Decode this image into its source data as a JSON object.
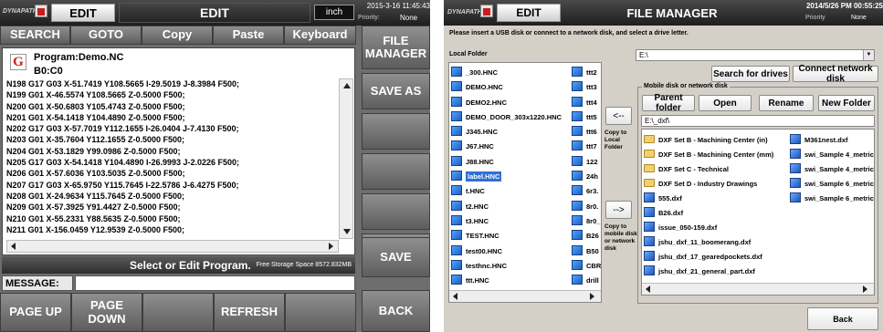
{
  "left": {
    "logo": "DYNAPATH",
    "tab_label": "EDIT",
    "title": "EDIT",
    "unit": "inch",
    "datetime": "2015-3-16 11:45:43",
    "priority_label": "Priority:",
    "priority_value": "None",
    "top_buttons": [
      "SEARCH",
      "GOTO",
      "Copy",
      "Paste",
      "Keyboard"
    ],
    "program_label": "Program:Demo.NC",
    "block": "B0:C0",
    "code_lines": [
      "N198 G17 G03 X-51.7419 Y108.5665 I-29.5019 J-8.3984 F500;",
      "N199 G01 X-46.5574 Y108.5665 Z-0.5000 F500;",
      "N200 G01 X-50.6803 Y105.4743 Z-0.5000 F500;",
      "N201 G01 X-54.1418 Y104.4890 Z-0.5000 F500;",
      "N202 G17 G03 X-57.7019 Y112.1655 I-26.0404 J-7.4130 F500;",
      "N203 G01 X-35.7604 Y112.1655 Z-0.5000 F500;",
      "N204 G01 X-53.1829 Y99.0986 Z-0.5000 F500;",
      "N205 G17 G03 X-54.1418 Y104.4890 I-26.9993 J-2.0226 F500;",
      "N206 G01 X-57.6036 Y103.5035 Z-0.5000 F500;",
      "N207 G17 G03 X-65.9750 Y115.7645 I-22.5786 J-6.4275 F500;",
      "N208 G01 X-24.9634 Y115.7645 Z-0.5000 F500;",
      "N209 G01 X-57.3925 Y91.4427 Z-0.5000 F500;",
      "N210 G01 X-55.2331 Y88.5635 Z-0.5000 F500;",
      "N211 G01 X-156.0459 Y12.9539 Z-0.5000 F500;"
    ],
    "status": "Select or Edit Program.",
    "storage": "Free Storage Space 8572.832MB",
    "message_label": "MESSAGE:",
    "side_buttons": [
      "FILE MANAGER",
      "SAVE AS",
      "",
      "",
      "",
      "",
      "SAVE",
      "BACK"
    ],
    "bottom_buttons": [
      "PAGE UP",
      "PAGE DOWN",
      "",
      "REFRESH",
      ""
    ]
  },
  "right": {
    "logo": "DYNAPATH",
    "tab_label": "EDIT",
    "title": "FILE MANAGER",
    "datetime": "2014/5/26 PM 00:55:25",
    "priority_label": "Priority",
    "priority_value": "None",
    "instruction": "Please insert a USB disk or connect to a network disk, and select a drive letter.",
    "local_folder_label": "Local Folder",
    "drive_value": "E:\\",
    "search_drives": "Search for drives",
    "connect_network": "Connect network disk",
    "mobile_group_label": "Mobile disk or network disk",
    "parent_folder": "Parent folder",
    "open": "Open",
    "rename": "Rename",
    "new_folder": "New Folder",
    "path_value": "E:\\_dxf\\",
    "copy_to_local": "Copy to Local Folder",
    "copy_to_mobile": "Copy to mobile disk or network disk",
    "back": "Back",
    "local_col1": [
      "_300.HNC",
      "DEMO.HNC",
      "DEMO2.HNC",
      "DEMO_DOOR_303x1220.HNC",
      "J345.HNC",
      "J67.HNC",
      "J88.HNC",
      "label.HNC",
      "t.HNC",
      "t2.HNC",
      "t3.HNC",
      "TEST.HNC",
      "test00.HNC",
      "testhnc.HNC",
      "ttt.HNC"
    ],
    "local_col2": [
      "ttt2",
      "ttt3",
      "ttt4",
      "ttt5",
      "ttt6",
      "ttt7",
      "122",
      "24h",
      "6r3.",
      "8r0.",
      "8r0_",
      "B26",
      "B50",
      "CBR",
      "drill"
    ],
    "mobile_col1": [
      {
        "name": "DXF Set B - Machining Center (in)",
        "type": "folder"
      },
      {
        "name": "DXF Set B - Machining Center (mm)",
        "type": "folder"
      },
      {
        "name": "DXF Set C - Technical",
        "type": "folder"
      },
      {
        "name": "DXF Set D - Industry Drawings",
        "type": "folder"
      },
      {
        "name": "555.dxf",
        "type": "file"
      },
      {
        "name": "B26.dxf",
        "type": "file"
      },
      {
        "name": "issue_050-159.dxf",
        "type": "file"
      },
      {
        "name": "jshu_dxf_11_boomerang.dxf",
        "type": "file"
      },
      {
        "name": "jshu_dxf_17_gearedpockets.dxf",
        "type": "file"
      },
      {
        "name": "jshu_dxf_21_general_part.dxf",
        "type": "file"
      }
    ],
    "mobile_col2": [
      "M361nest.dxf",
      "swi_Sample 4_metric.",
      "swi_Sample 4_metric_",
      "swi_Sample 6_metric.",
      "swi_Sample 6_metric_"
    ]
  },
  "colors": {
    "header_dark": "#2a2a2a",
    "button_gray": "#6e6e6e",
    "selected_blue": "#2f6fd6",
    "logo_red": "#c81e1e"
  }
}
